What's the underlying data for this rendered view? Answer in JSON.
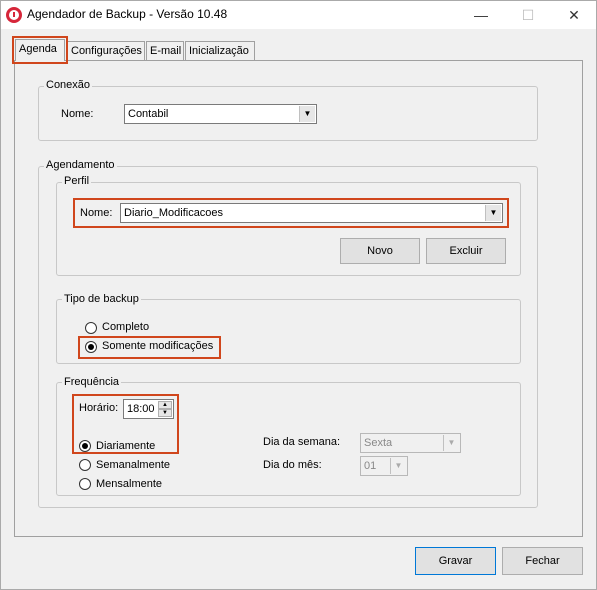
{
  "window": {
    "title": "Agendador de Backup - Versão 10.48"
  },
  "tabs": [
    {
      "label": "Agenda",
      "active": true
    },
    {
      "label": "Configurações",
      "active": false
    },
    {
      "label": "E-mail",
      "active": false
    },
    {
      "label": "Inicialização",
      "active": false
    }
  ],
  "conexao": {
    "group_label": "Conexão",
    "nome_label": "Nome:",
    "nome_value": "Contabil"
  },
  "agendamento": {
    "group_label": "Agendamento",
    "perfil": {
      "group_label": "Perfil",
      "nome_label": "Nome:",
      "nome_value": "Diario_Modificacoes",
      "novo_label": "Novo",
      "excluir_label": "Excluir"
    },
    "tipo_backup": {
      "group_label": "Tipo de backup",
      "options": [
        {
          "label": "Completo",
          "checked": false
        },
        {
          "label": "Somente modificações",
          "checked": true
        }
      ]
    },
    "frequencia": {
      "group_label": "Frequência",
      "horario_label": "Horário:",
      "horario_value": "18:00",
      "options": [
        {
          "label": "Diariamente",
          "checked": true
        },
        {
          "label": "Semanalmente",
          "checked": false
        },
        {
          "label": "Mensalmente",
          "checked": false
        }
      ],
      "dia_semana_label": "Dia da semana:",
      "dia_semana_value": "Sexta",
      "dia_mes_label": "Dia do mês:",
      "dia_mes_value": "01"
    }
  },
  "footer": {
    "gravar_label": "Gravar",
    "fechar_label": "Fechar"
  },
  "colors": {
    "highlight": "#d0461c",
    "accent": "#0078d7",
    "app_icon": "#d6263a"
  }
}
